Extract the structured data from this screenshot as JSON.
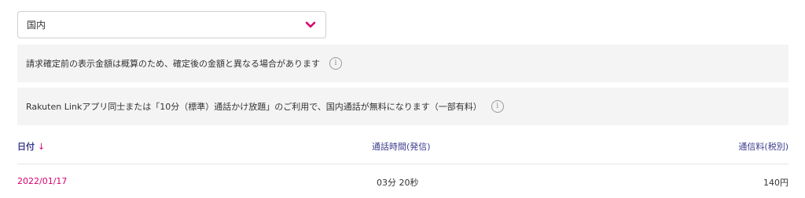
{
  "region_select": {
    "value": "国内",
    "icon": "chevron-down-icon",
    "icon_color": "#d6006e"
  },
  "notices": [
    {
      "text": "請求確定前の表示金額は概算のため、確定後の金額と異なる場合があります",
      "icon": "info-icon",
      "icon_glyph": "i"
    },
    {
      "text": "Rakuten Linkアプリ同士または「10分（標準）通話かけ放題」のご利用で、国内通話が無料になります（一部有料）",
      "icon": "info-icon",
      "icon_glyph": "i"
    }
  ],
  "table": {
    "headers": {
      "date": "日付",
      "sort_arrow": "↓",
      "duration": "通話時間(発信)",
      "fee": "通信料(税別)"
    },
    "rows": [
      {
        "date": "2022/01/17",
        "duration": "03分 20秒",
        "fee": "140円"
      }
    ]
  },
  "colors": {
    "accent": "#d6006e",
    "header_text": "#3d3d8f",
    "notice_bg": "#f4f4f4"
  }
}
